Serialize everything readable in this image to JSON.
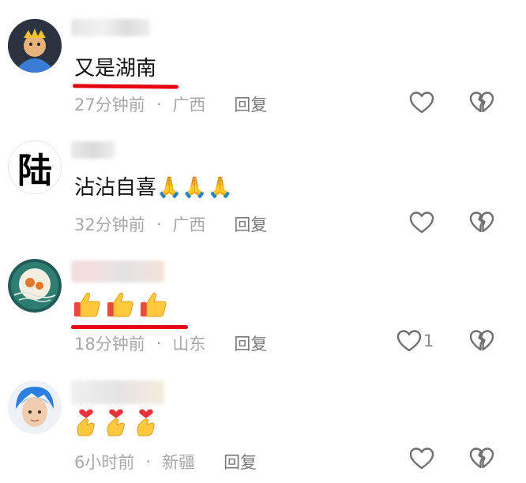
{
  "comments": [
    {
      "text": "又是湖南",
      "time": "27分钟前",
      "location": "广西",
      "reply_label": "回复",
      "like_count": "",
      "avatar_icon": "cartoon-king-avatar"
    },
    {
      "text": "沾沾自喜🙏🙏🙏",
      "time": "32分钟前",
      "location": "广西",
      "reply_label": "回复",
      "like_count": "",
      "avatar_icon": "calligraphy-lu-avatar",
      "avatar_glyph": "陆"
    },
    {
      "emojis": [
        "thumbs-up",
        "thumbs-up",
        "thumbs-up"
      ],
      "time": "18分钟前",
      "location": "山东",
      "reply_label": "回复",
      "like_count": "1",
      "avatar_icon": "teal-circle-avatar"
    },
    {
      "emojis": [
        "finger-heart",
        "finger-heart",
        "finger-heart"
      ],
      "time": "6小时前",
      "location": "新疆",
      "reply_label": "回复",
      "like_count": "",
      "avatar_icon": "blue-hair-person-avatar"
    }
  ],
  "separator": "·",
  "colors": {
    "underline": "#e60012",
    "meta_text": "#a8a8a8",
    "icon_stroke": "#6f6f6f"
  }
}
